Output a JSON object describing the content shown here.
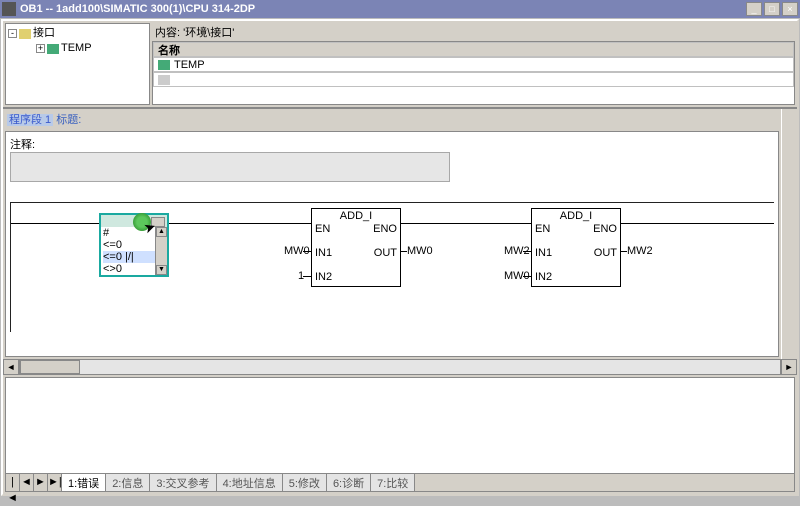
{
  "title": "OB1 -- 1add100\\SIMATIC 300(1)\\CPU 314-2DP",
  "window_buttons": {
    "min": "_",
    "max": "□",
    "close": "×"
  },
  "tree": {
    "root": {
      "expander": "-",
      "label": "接口"
    },
    "child": {
      "expander": "+",
      "label": "TEMP"
    }
  },
  "table": {
    "content_label": "内容:  '环境\\接口'",
    "header": "名称",
    "rows": [
      "TEMP",
      ""
    ]
  },
  "network": {
    "title_prefix": "程序段 1",
    "title_suffix": "标题:",
    "comment_label": "注释:"
  },
  "dropdown": {
    "items": [
      "#",
      "<=0",
      "<=0  |/|",
      "<>0"
    ]
  },
  "blocks": {
    "b1": {
      "title": "ADD_I",
      "en": "EN",
      "eno": "ENO",
      "in1": "IN1",
      "out": "OUT",
      "in2": "IN2",
      "left_in1": "MW0",
      "right_out": "MW0",
      "left_in2": "1"
    },
    "b2": {
      "title": "ADD_I",
      "en": "EN",
      "eno": "ENO",
      "in1": "IN1",
      "out": "OUT",
      "in2": "IN2",
      "left_in1": "MW2",
      "right_out": "MW2",
      "left_in2": "MW0"
    }
  },
  "tabs": [
    "1:错误",
    "2:信息",
    "3:交叉参考",
    "4:地址信息",
    "5:修改",
    "6:诊断",
    "7:比较"
  ]
}
